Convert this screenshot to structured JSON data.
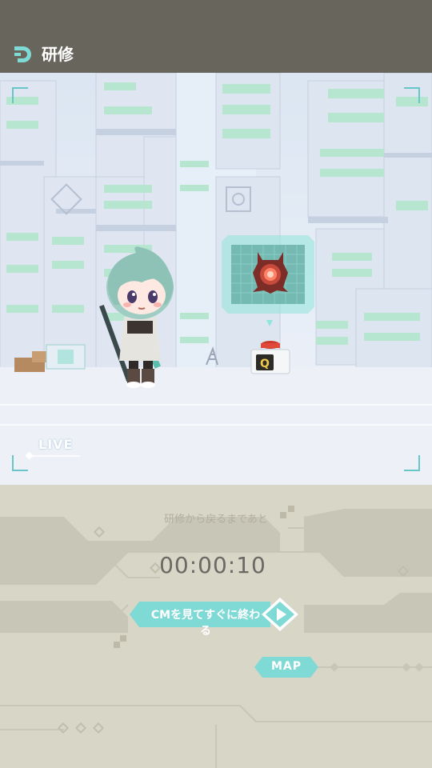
{
  "header": {
    "title": "研修"
  },
  "scene": {
    "live_label": "LIVE",
    "target_box_key": "Q",
    "icons": [
      "app-logo-icon",
      "enemy-robot-icon",
      "play-triangle-icon"
    ]
  },
  "panel": {
    "caption": "研修から戻るまであと",
    "timer": "00:00:10",
    "cm_button_label": "CMを見てすぐに終わる",
    "map_button_label": "MAP"
  },
  "colors": {
    "header_bg": "#67655c",
    "accent_teal": "#7fd9d4",
    "panel_bg": "#d8d6c6",
    "timer_text": "#6a6963"
  }
}
